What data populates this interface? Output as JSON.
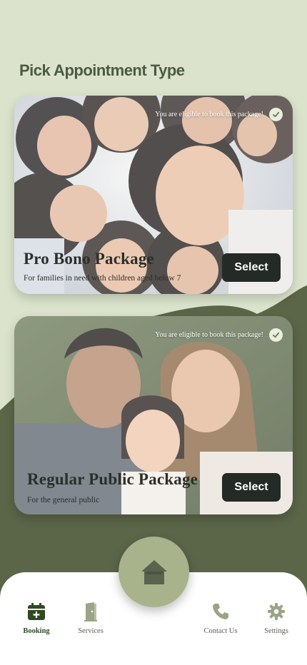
{
  "page": {
    "title": "Pick Appointment Type"
  },
  "colors": {
    "background": "#dbe3cc",
    "blob": "#5b6548",
    "accent": "#a8b38c",
    "button": "#242a26",
    "active_nav": "#2f4a23",
    "inactive_icon": "#9aa585"
  },
  "packages": [
    {
      "eligibility": "You are eligible to book this package!",
      "title": "Pro Bono Package",
      "subtitle": "For families in need with children aged below 7",
      "select_label": "Select",
      "image": "group-of-smiling-children"
    },
    {
      "eligibility": "You are eligible to book this package!",
      "title": "Regular Public Package",
      "subtitle": "For the general public",
      "select_label": "Select",
      "image": "family-portrait"
    }
  ],
  "nav": {
    "items": [
      {
        "label": "Booking",
        "icon": "calendar-plus-icon",
        "active": true
      },
      {
        "label": "Services",
        "icon": "door-icon",
        "active": false
      },
      {
        "label": "Contact Us",
        "icon": "phone-icon",
        "active": false
      },
      {
        "label": "Settings",
        "icon": "gear-icon",
        "active": false
      }
    ],
    "home_icon": "home-icon"
  }
}
